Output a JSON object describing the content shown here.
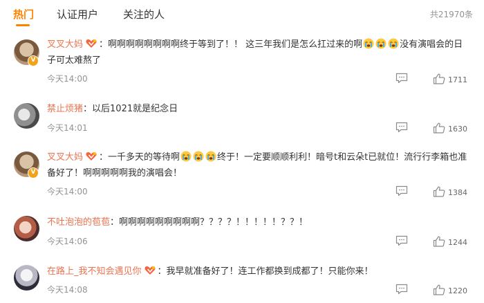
{
  "tabs": [
    "热门",
    "认证用户",
    "关注的人"
  ],
  "total": "共21970条",
  "comments": [
    {
      "user": "叉叉大妈",
      "colon": "：",
      "content_a": "啊啊啊啊啊啊啊啊终于等到了！！ 这三年我们是怎么扛过来的啊",
      "content_b": "没有演唱会的日子可太难熬了",
      "time": "今天14:00",
      "likes": "1711"
    },
    {
      "user": "禁止烦猪",
      "colon": "：",
      "content_a": "以后1021就是纪念日",
      "time": "今天14:01",
      "likes": "1630"
    },
    {
      "user": "叉叉大妈",
      "colon": "：",
      "content_a": "一千多天的等待啊",
      "content_b": "终于！一定要顺顺利利！暗号t和云朵t已就位！流行行李箱也准备好了！啊啊啊啊啊我的演唱会！",
      "time": "今天14:00",
      "likes": "1384"
    },
    {
      "user": "不吐泡泡的苞苞",
      "colon": "：",
      "content_a": "啊啊啊啊啊啊啊啊啊？？？？！！！！！？？！",
      "time": "今天14:06",
      "likes": "1244"
    },
    {
      "user": "在路上_我不知会遇见你",
      "colon": "：",
      "content_a": "我早就准备好了！连工作都换到成都了！只能你来！",
      "time": "今天14:08",
      "likes": "1220"
    }
  ],
  "icons": {
    "reply": "comment-icon",
    "like": "thumbs-up-icon",
    "medal": "fan-medal-icon",
    "emoji": "crying-emoji-icon",
    "verified": "verified-v-icon"
  },
  "colors": {
    "accent": "#ff8200",
    "username": "#eb7350",
    "meta": "#939393"
  }
}
